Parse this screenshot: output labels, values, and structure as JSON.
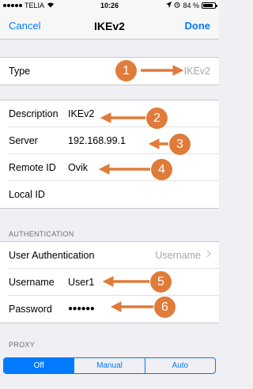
{
  "status": {
    "carrier": "TELIA",
    "time": "10:26",
    "battery": "84 %",
    "battery_fill": 0.84
  },
  "nav": {
    "cancel": "Cancel",
    "title": "IKEv2",
    "done": "Done"
  },
  "type_row": {
    "label": "Type",
    "value": "IKEv2"
  },
  "connection": {
    "description": {
      "label": "Description",
      "value": "IKEv2"
    },
    "server": {
      "label": "Server",
      "value": "192.168.99.1"
    },
    "remote_id": {
      "label": "Remote ID",
      "value": "Ovik"
    },
    "local_id": {
      "label": "Local ID",
      "value": ""
    }
  },
  "authentication": {
    "header": "AUTHENTICATION",
    "user_auth": {
      "label": "User Authentication",
      "value": "Username"
    },
    "username": {
      "label": "Username",
      "value": "User1"
    },
    "password": {
      "label": "Password",
      "value": "●●●●●●"
    }
  },
  "proxy": {
    "header": "PROXY",
    "options": [
      "Off",
      "Manual",
      "Auto"
    ],
    "selected": "Off"
  },
  "annotations": {
    "numbers": [
      "1",
      "2",
      "3",
      "4",
      "5",
      "6"
    ],
    "color": "#e07b3a"
  },
  "colors": {
    "accent": "#007aff",
    "annotation": "#e07b3a"
  }
}
